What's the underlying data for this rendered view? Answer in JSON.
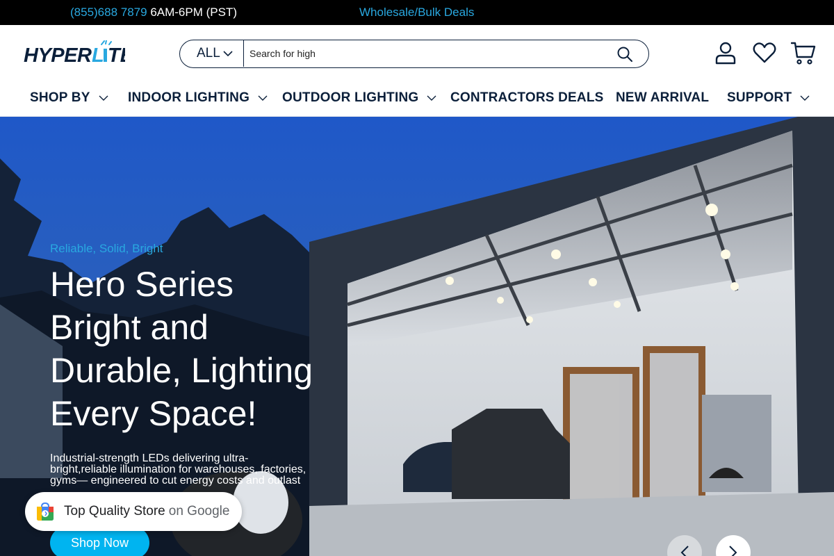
{
  "topbar": {
    "phone": "(855)688 7879",
    "hours": " 6AM-6PM (PST)",
    "wholesale": "Wholesale/Bulk Deals"
  },
  "header": {
    "logo_text": "HYPERLITE",
    "search": {
      "category": "ALL",
      "value": "Search for high"
    },
    "icons": [
      "account-icon",
      "wishlist-heart-icon",
      "cart-icon"
    ]
  },
  "nav": {
    "items": [
      {
        "label": "SHOP BY"
      },
      {
        "label": "INDOOR LIGHTING"
      },
      {
        "label": "OUTDOOR LIGHTING"
      },
      {
        "label": "CONTRACTORS DEALS"
      },
      {
        "label": "NEW ARRIVAL"
      },
      {
        "label": "SUPPORT"
      }
    ]
  },
  "hero": {
    "eyebrow": "Reliable, Solid, Bright",
    "title": "Hero Series Bright and Durable, Lighting Every Space!",
    "description": "Industrial-strength LEDs delivering ultra-bright,reliable illumination for warehouses, factories, gyms— engineered to cut energy costs and outlast",
    "cta": "Shop Now"
  },
  "badge": {
    "strong": "Top Quality Store",
    "light": "on Google"
  },
  "colors": {
    "accent": "#29a8e0",
    "cta": "#00b4f0",
    "navy": "#0b1f3a",
    "topbar": "#000000"
  }
}
